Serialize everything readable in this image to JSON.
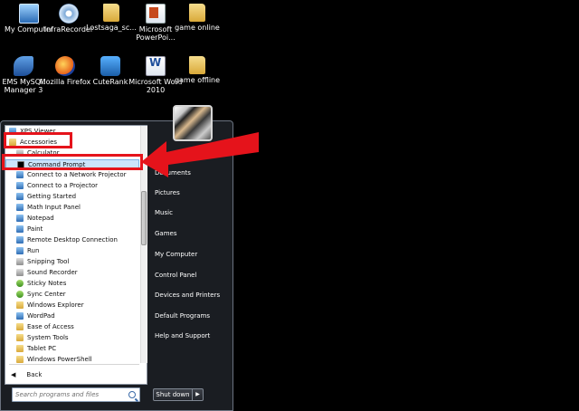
{
  "desktop": {
    "icons": [
      {
        "label": "My Computer",
        "icon": "computer-icon"
      },
      {
        "label": "InfraRecorder",
        "icon": "cd-icon"
      },
      {
        "label": "Lostsaga_sc...",
        "icon": "folder-icon"
      },
      {
        "label": "Microsoft PowerPoi...",
        "icon": "powerpoint-icon"
      },
      {
        "label": "game online",
        "icon": "folder-icon"
      },
      {
        "label": "EMS MySQL Manager 3",
        "icon": "ems-icon"
      },
      {
        "label": "Mozilla Firefox",
        "icon": "firefox-icon"
      },
      {
        "label": "CuteRank",
        "icon": "cuterank-icon"
      },
      {
        "label": "Microsoft Word 2010",
        "icon": "word-icon"
      },
      {
        "label": "game offline",
        "icon": "folder-icon"
      }
    ]
  },
  "start_menu": {
    "programs": [
      {
        "label": "XPS Viewer",
        "icon": "app-icon"
      },
      {
        "label": "Accessories",
        "icon": "folder-icon"
      },
      {
        "label": "Calculator",
        "icon": "app-icon"
      },
      {
        "label": "Command Prompt",
        "icon": "cmd-icon"
      },
      {
        "label": "Connect to a Network Projector",
        "icon": "app-icon"
      },
      {
        "label": "Connect to a Projector",
        "icon": "app-icon"
      },
      {
        "label": "Getting Started",
        "icon": "app-icon"
      },
      {
        "label": "Math Input Panel",
        "icon": "app-icon"
      },
      {
        "label": "Notepad",
        "icon": "app-icon"
      },
      {
        "label": "Paint",
        "icon": "app-icon"
      },
      {
        "label": "Remote Desktop Connection",
        "icon": "app-icon"
      },
      {
        "label": "Run",
        "icon": "app-icon"
      },
      {
        "label": "Snipping Tool",
        "icon": "app-icon"
      },
      {
        "label": "Sound Recorder",
        "icon": "app-icon"
      },
      {
        "label": "Sticky Notes",
        "icon": "app-icon"
      },
      {
        "label": "Sync Center",
        "icon": "app-icon"
      },
      {
        "label": "Windows Explorer",
        "icon": "app-icon"
      },
      {
        "label": "WordPad",
        "icon": "app-icon"
      },
      {
        "label": "Ease of Access",
        "icon": "folder-icon"
      },
      {
        "label": "System Tools",
        "icon": "folder-icon"
      },
      {
        "label": "Tablet PC",
        "icon": "folder-icon"
      },
      {
        "label": "Windows PowerShell",
        "icon": "folder-icon"
      }
    ],
    "back_label": "Back",
    "search_placeholder": "Search programs and files",
    "right_items": [
      {
        "label": "Documents"
      },
      {
        "label": "Pictures"
      },
      {
        "label": "Music"
      },
      {
        "label": "Games"
      },
      {
        "label": "My Computer"
      },
      {
        "label": "Control Panel"
      },
      {
        "label": "Devices and Printers"
      },
      {
        "label": "Default Programs"
      },
      {
        "label": "Help and Support"
      }
    ],
    "shutdown_label": "Shut down"
  },
  "colors": {
    "annotation_red": "#e5131b",
    "menu_dark": "#1a1d22",
    "selection_blue": "#cce4fb"
  }
}
